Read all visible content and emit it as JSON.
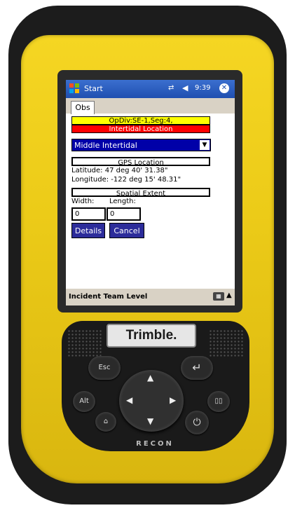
{
  "titlebar": {
    "app_title": "Start",
    "time": "9:39",
    "ok_label": "ok"
  },
  "tabs": [
    {
      "label": "Obs"
    }
  ],
  "form": {
    "banner_yellow": "OpDiv:SE-1,Seg:4,",
    "banner_red": "Intertidal Location",
    "zone_selected": "Middle Intertidal",
    "gps_heading": "GPS Location",
    "latitude_line": "Latitude:   47 deg 40' 31.38\"",
    "longitude_line": "Longitude: -122 deg 15' 48.31\"",
    "spatial_heading": "Spatial Extent",
    "width_label": "Width:",
    "length_label": "Length:",
    "width_value": "0",
    "length_value": "0",
    "details_button": "Details",
    "cancel_button": "Cancel"
  },
  "menubar": {
    "label": "Incident Team Level"
  },
  "keypad": {
    "brand": "Trimble.",
    "model": "RECON",
    "esc": "Esc",
    "alt": "Alt"
  },
  "colors": {
    "device_yellow": "#eccb18",
    "titlebar_blue": "#1f4fb0",
    "dropdown_blue": "#0000a8",
    "banner_yellow": "#ffff00",
    "banner_red": "#ff0000",
    "button_blue": "#2c2c9a"
  }
}
